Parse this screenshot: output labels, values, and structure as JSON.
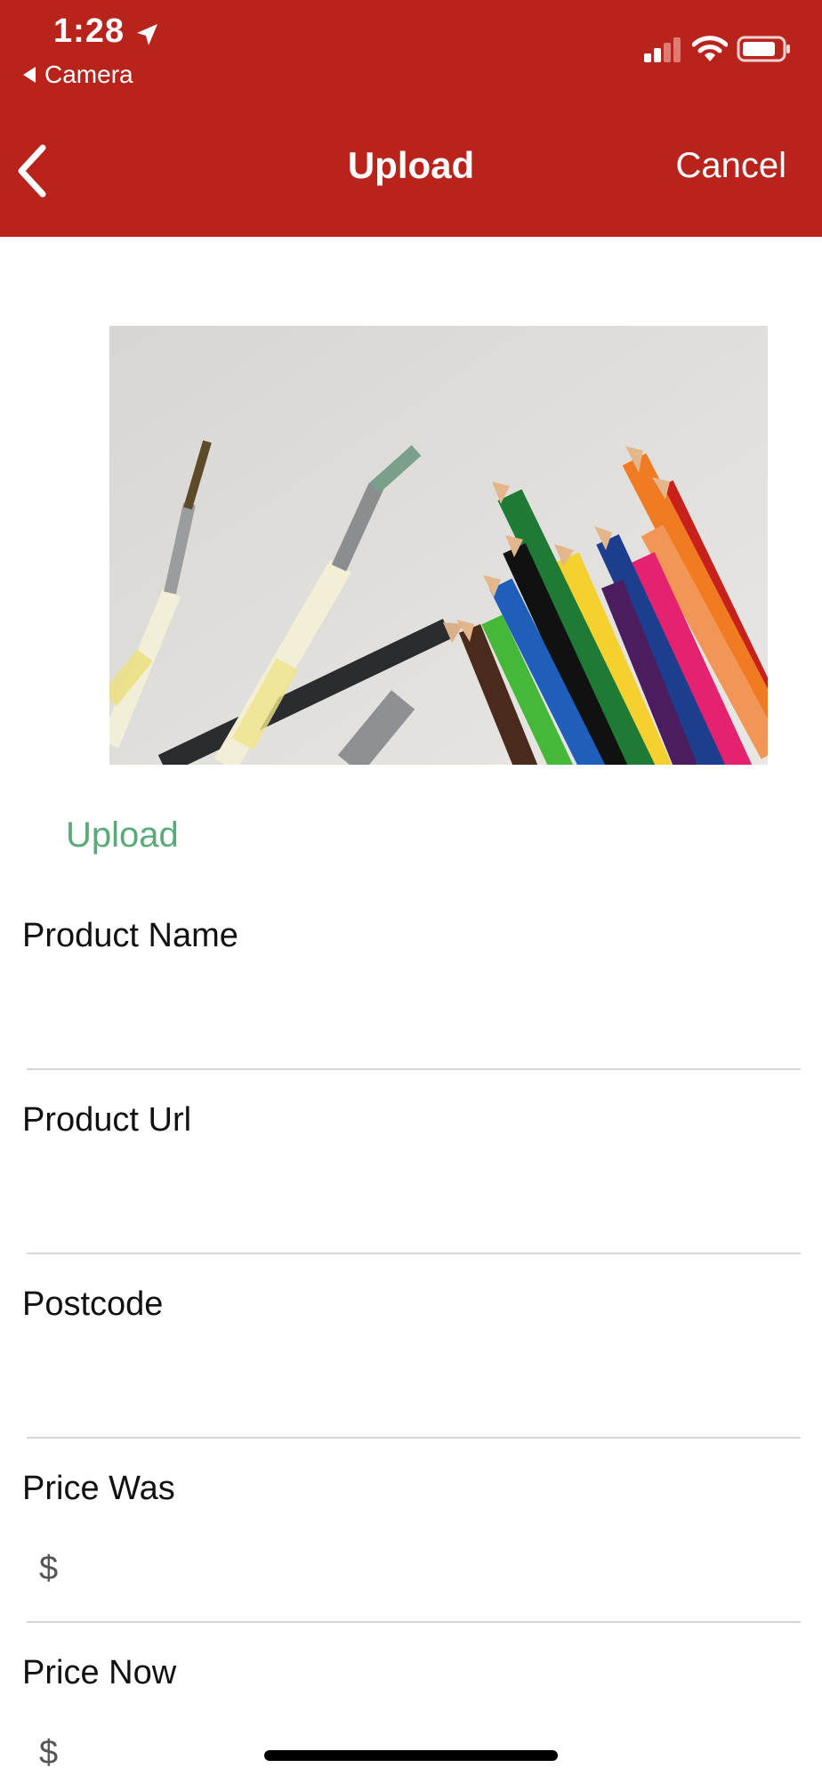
{
  "status": {
    "time": "1:28",
    "back_app": "Camera"
  },
  "nav": {
    "title": "Upload",
    "cancel": "Cancel"
  },
  "upload_label": "Upload",
  "fields": {
    "product_name": {
      "label": "Product Name",
      "value": ""
    },
    "product_url": {
      "label": "Product Url",
      "value": ""
    },
    "postcode": {
      "label": "Postcode",
      "value": ""
    },
    "price_was": {
      "label": "Price Was",
      "currency": "$",
      "value": ""
    },
    "price_now": {
      "label": "Price Now",
      "currency": "$",
      "value": ""
    }
  },
  "colors": {
    "header": "#b8241b",
    "upload_link": "#5aa978"
  },
  "icons": [
    "location-arrow-icon",
    "back-triangle-icon",
    "signal-icon",
    "wifi-icon",
    "battery-icon",
    "chevron-left-icon"
  ]
}
